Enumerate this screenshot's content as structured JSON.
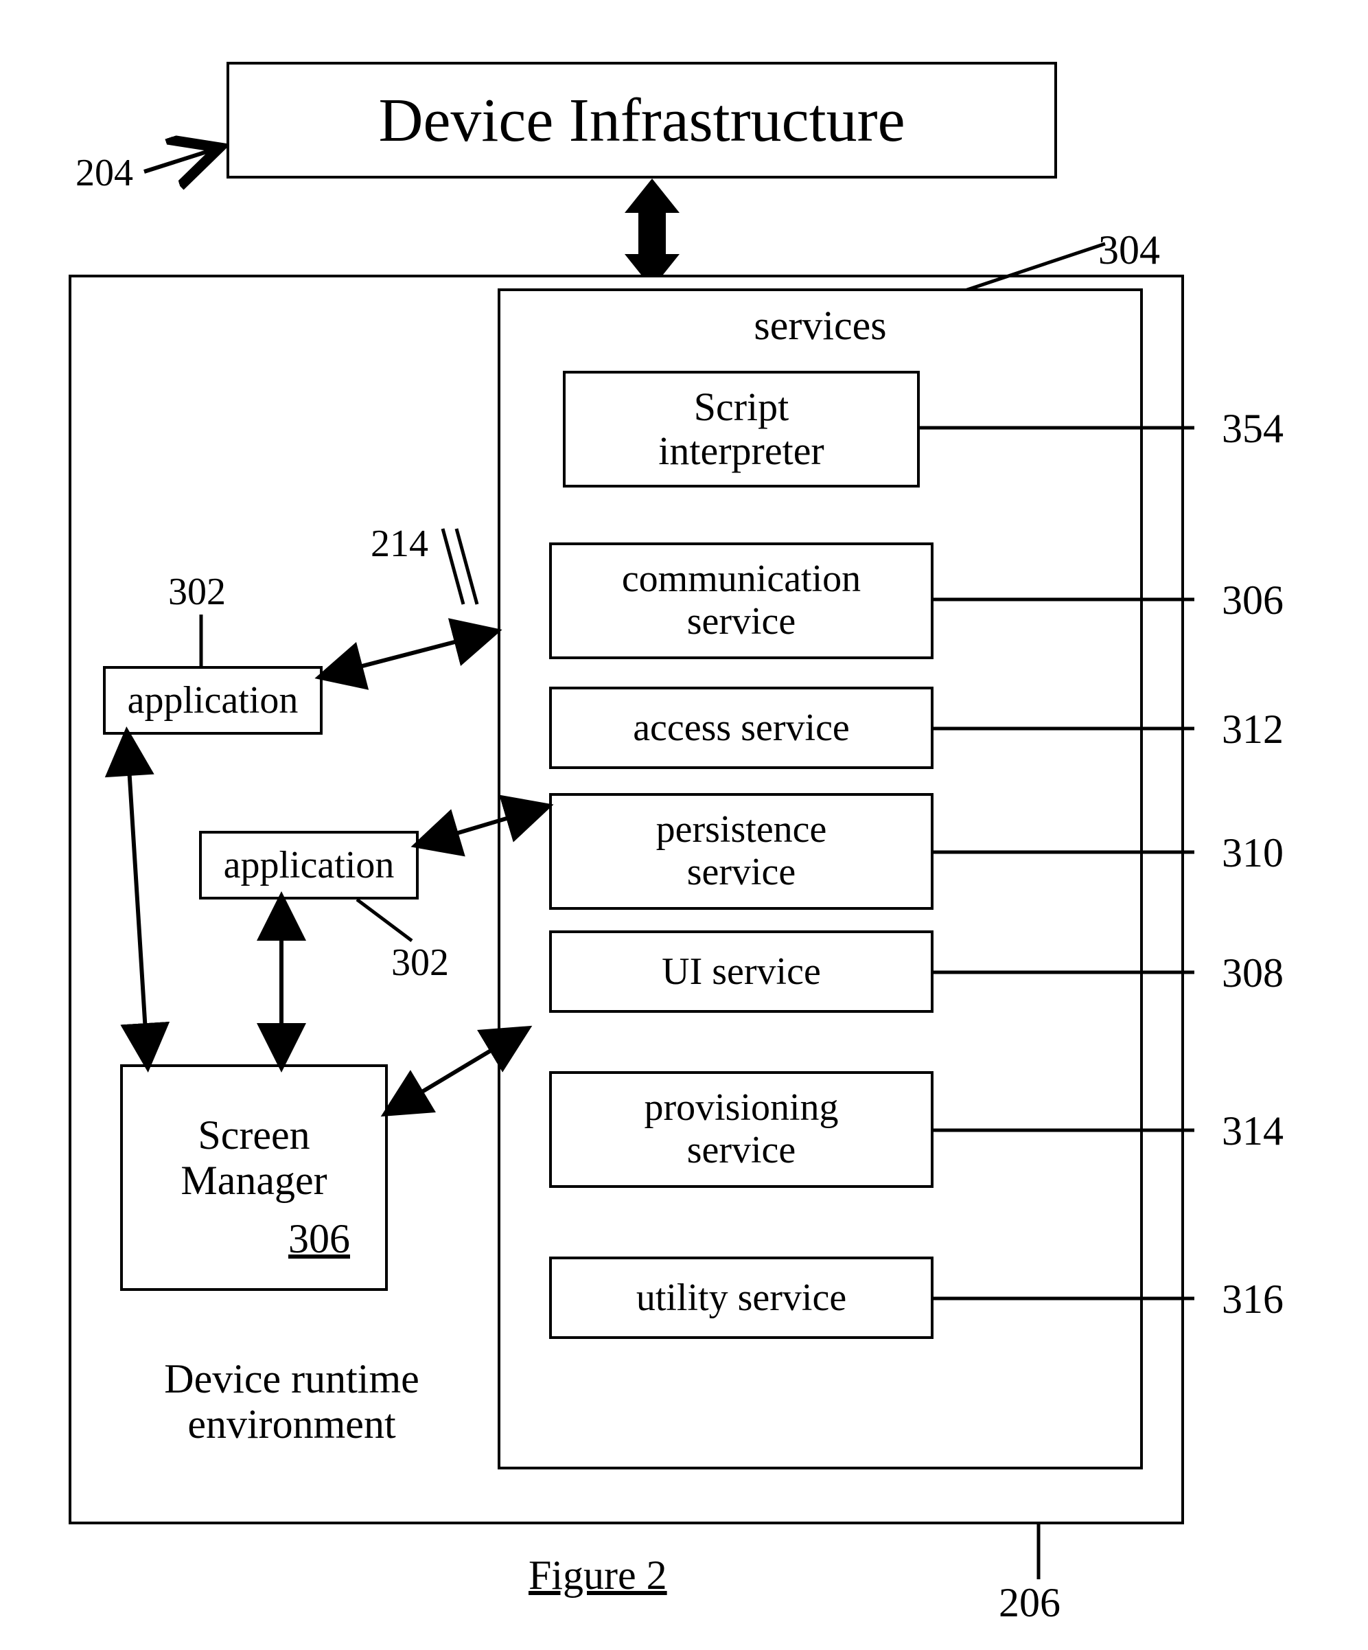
{
  "captions": {
    "figure": "Figure 2"
  },
  "refs": {
    "r204": "204",
    "r206": "206",
    "r214": "214",
    "r302a": "302",
    "r302b": "302",
    "r304": "304",
    "r306_num": "306",
    "r306_sv": "306",
    "r308": "308",
    "r310": "310",
    "r312": "312",
    "r314": "314",
    "r316": "316",
    "r354": "354"
  },
  "blocks": {
    "device_infra": "Device Infrastructure",
    "services_title": "services",
    "script_interpreter": "Script\ninterpreter",
    "communication_service": "communication\nservice",
    "access_service": "access service",
    "persistence_service": "persistence\nservice",
    "ui_service": "UI service",
    "provisioning_service": "provisioning\nservice",
    "utility_service": "utility service",
    "application": "application",
    "screen_manager_label": "Screen\nManager",
    "runtime_env": "Device runtime\nenvironment"
  }
}
